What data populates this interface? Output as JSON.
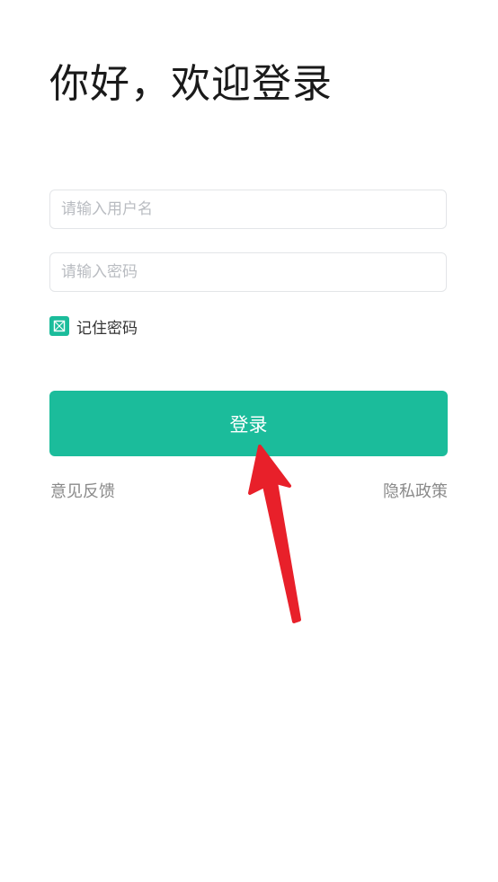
{
  "login": {
    "title": "你好，欢迎登录",
    "username_placeholder": "请输入用户名",
    "password_placeholder": "请输入密码",
    "remember_label": "记住密码",
    "remember_checked": true,
    "login_label": "登录",
    "feedback_label": "意见反馈",
    "privacy_label": "隐私政策"
  },
  "colors": {
    "accent": "#1bbc9b",
    "annotation_arrow": "#e8202a",
    "title_text": "#1a1a1a",
    "link_text": "#8a8a8a",
    "placeholder_text": "#b9bcc1"
  }
}
